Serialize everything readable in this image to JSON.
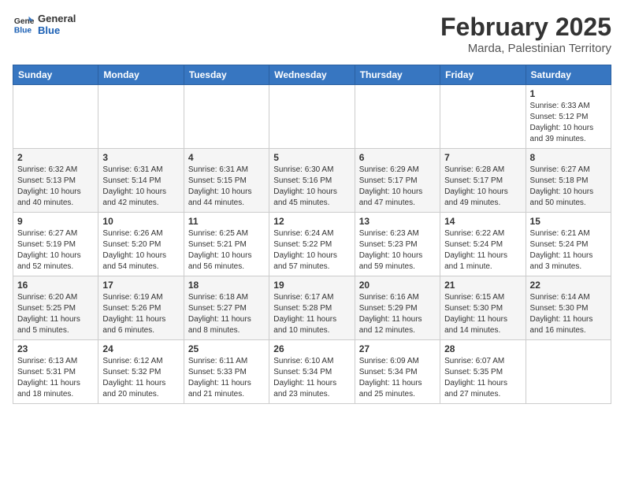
{
  "header": {
    "logo_general": "General",
    "logo_blue": "Blue",
    "month": "February 2025",
    "location": "Marda, Palestinian Territory"
  },
  "days_of_week": [
    "Sunday",
    "Monday",
    "Tuesday",
    "Wednesday",
    "Thursday",
    "Friday",
    "Saturday"
  ],
  "weeks": [
    [
      {
        "day": "",
        "info": ""
      },
      {
        "day": "",
        "info": ""
      },
      {
        "day": "",
        "info": ""
      },
      {
        "day": "",
        "info": ""
      },
      {
        "day": "",
        "info": ""
      },
      {
        "day": "",
        "info": ""
      },
      {
        "day": "1",
        "info": "Sunrise: 6:33 AM\nSunset: 5:12 PM\nDaylight: 10 hours\nand 39 minutes."
      }
    ],
    [
      {
        "day": "2",
        "info": "Sunrise: 6:32 AM\nSunset: 5:13 PM\nDaylight: 10 hours\nand 40 minutes."
      },
      {
        "day": "3",
        "info": "Sunrise: 6:31 AM\nSunset: 5:14 PM\nDaylight: 10 hours\nand 42 minutes."
      },
      {
        "day": "4",
        "info": "Sunrise: 6:31 AM\nSunset: 5:15 PM\nDaylight: 10 hours\nand 44 minutes."
      },
      {
        "day": "5",
        "info": "Sunrise: 6:30 AM\nSunset: 5:16 PM\nDaylight: 10 hours\nand 45 minutes."
      },
      {
        "day": "6",
        "info": "Sunrise: 6:29 AM\nSunset: 5:17 PM\nDaylight: 10 hours\nand 47 minutes."
      },
      {
        "day": "7",
        "info": "Sunrise: 6:28 AM\nSunset: 5:17 PM\nDaylight: 10 hours\nand 49 minutes."
      },
      {
        "day": "8",
        "info": "Sunrise: 6:27 AM\nSunset: 5:18 PM\nDaylight: 10 hours\nand 50 minutes."
      }
    ],
    [
      {
        "day": "9",
        "info": "Sunrise: 6:27 AM\nSunset: 5:19 PM\nDaylight: 10 hours\nand 52 minutes."
      },
      {
        "day": "10",
        "info": "Sunrise: 6:26 AM\nSunset: 5:20 PM\nDaylight: 10 hours\nand 54 minutes."
      },
      {
        "day": "11",
        "info": "Sunrise: 6:25 AM\nSunset: 5:21 PM\nDaylight: 10 hours\nand 56 minutes."
      },
      {
        "day": "12",
        "info": "Sunrise: 6:24 AM\nSunset: 5:22 PM\nDaylight: 10 hours\nand 57 minutes."
      },
      {
        "day": "13",
        "info": "Sunrise: 6:23 AM\nSunset: 5:23 PM\nDaylight: 10 hours\nand 59 minutes."
      },
      {
        "day": "14",
        "info": "Sunrise: 6:22 AM\nSunset: 5:24 PM\nDaylight: 11 hours\nand 1 minute."
      },
      {
        "day": "15",
        "info": "Sunrise: 6:21 AM\nSunset: 5:24 PM\nDaylight: 11 hours\nand 3 minutes."
      }
    ],
    [
      {
        "day": "16",
        "info": "Sunrise: 6:20 AM\nSunset: 5:25 PM\nDaylight: 11 hours\nand 5 minutes."
      },
      {
        "day": "17",
        "info": "Sunrise: 6:19 AM\nSunset: 5:26 PM\nDaylight: 11 hours\nand 6 minutes."
      },
      {
        "day": "18",
        "info": "Sunrise: 6:18 AM\nSunset: 5:27 PM\nDaylight: 11 hours\nand 8 minutes."
      },
      {
        "day": "19",
        "info": "Sunrise: 6:17 AM\nSunset: 5:28 PM\nDaylight: 11 hours\nand 10 minutes."
      },
      {
        "day": "20",
        "info": "Sunrise: 6:16 AM\nSunset: 5:29 PM\nDaylight: 11 hours\nand 12 minutes."
      },
      {
        "day": "21",
        "info": "Sunrise: 6:15 AM\nSunset: 5:30 PM\nDaylight: 11 hours\nand 14 minutes."
      },
      {
        "day": "22",
        "info": "Sunrise: 6:14 AM\nSunset: 5:30 PM\nDaylight: 11 hours\nand 16 minutes."
      }
    ],
    [
      {
        "day": "23",
        "info": "Sunrise: 6:13 AM\nSunset: 5:31 PM\nDaylight: 11 hours\nand 18 minutes."
      },
      {
        "day": "24",
        "info": "Sunrise: 6:12 AM\nSunset: 5:32 PM\nDaylight: 11 hours\nand 20 minutes."
      },
      {
        "day": "25",
        "info": "Sunrise: 6:11 AM\nSunset: 5:33 PM\nDaylight: 11 hours\nand 21 minutes."
      },
      {
        "day": "26",
        "info": "Sunrise: 6:10 AM\nSunset: 5:34 PM\nDaylight: 11 hours\nand 23 minutes."
      },
      {
        "day": "27",
        "info": "Sunrise: 6:09 AM\nSunset: 5:34 PM\nDaylight: 11 hours\nand 25 minutes."
      },
      {
        "day": "28",
        "info": "Sunrise: 6:07 AM\nSunset: 5:35 PM\nDaylight: 11 hours\nand 27 minutes."
      },
      {
        "day": "",
        "info": ""
      }
    ]
  ]
}
